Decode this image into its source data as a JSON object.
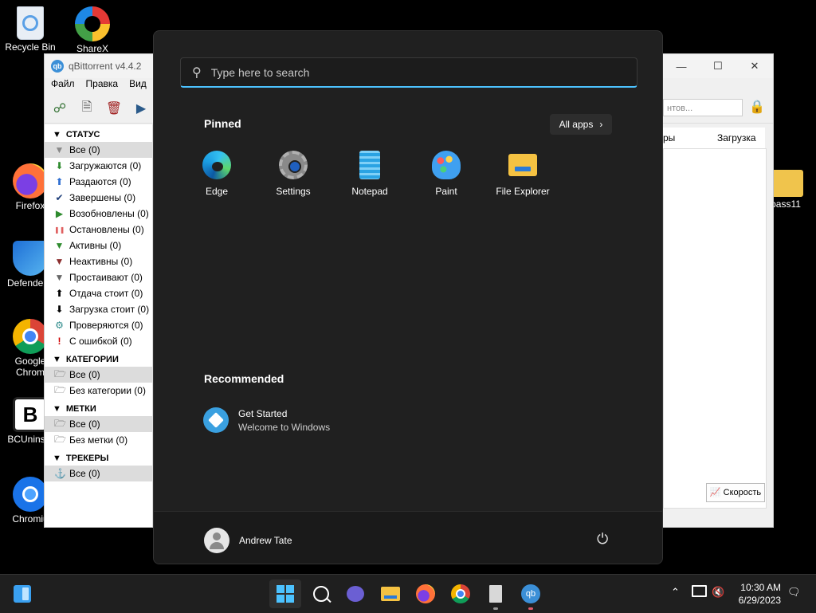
{
  "desktop": {
    "icons": [
      {
        "label": "Recycle Bin",
        "icon": "recycle-bin-icon"
      },
      {
        "label": "ShareX",
        "icon": "sharex-icon"
      },
      {
        "label": "Firefox",
        "icon": "firefox-icon"
      },
      {
        "label": "DefenderC",
        "icon": "defender-icon"
      },
      {
        "label": "Google",
        "label2": "Chrom",
        "icon": "chrome-icon"
      },
      {
        "label": "BCUninsta",
        "icon": "bcuninstaller-icon"
      },
      {
        "label": "Chromiu",
        "icon": "chromium-icon"
      },
      {
        "label": "pass11",
        "icon": "folder-icon"
      }
    ]
  },
  "qbittorrent": {
    "title": "qBittorrent v4.4.2",
    "menu": [
      "Файл",
      "Правка",
      "Вид"
    ],
    "search_placeholder": "нтов...",
    "columns": [
      "ры",
      "Загрузка"
    ],
    "speed_button": "Скорость",
    "sections": {
      "status": {
        "title": "СТАТУС",
        "items": [
          {
            "label": "Все (0)",
            "icon": "filter-icon",
            "color": "#888888"
          },
          {
            "label": "Загружаются (0)",
            "icon": "arrow-down-icon",
            "color": "#2e8b2e"
          },
          {
            "label": "Раздаются (0)",
            "icon": "arrow-up-icon",
            "color": "#2f6fd1"
          },
          {
            "label": "Завершены (0)",
            "icon": "check-icon",
            "color": "#1f3f7a"
          },
          {
            "label": "Возобновлены (0)",
            "icon": "play-icon",
            "color": "#2e8b2e"
          },
          {
            "label": "Остановлены (0)",
            "icon": "pause-icon",
            "color": "#e06060"
          },
          {
            "label": "Активны (0)",
            "icon": "filter-icon",
            "color": "#2e8b2e"
          },
          {
            "label": "Неактивны (0)",
            "icon": "filter-icon",
            "color": "#8b2e2e"
          },
          {
            "label": "Простаивают (0)",
            "icon": "filter-icon",
            "color": "#666666"
          },
          {
            "label": "Отдача стоит (0)",
            "icon": "arrow-up-icon",
            "color": "#000000"
          },
          {
            "label": "Загрузка стоит (0)",
            "icon": "arrow-down-icon",
            "color": "#000000"
          },
          {
            "label": "Проверяются (0)",
            "icon": "gear-icon",
            "color": "#2e8b8b"
          },
          {
            "label": "С ошибкой (0)",
            "icon": "error-icon",
            "color": "#d00000"
          }
        ]
      },
      "categories": {
        "title": "КАТЕГОРИИ",
        "items": [
          {
            "label": "Все (0)",
            "icon": "folder-open-icon"
          },
          {
            "label": "Без категории (0)",
            "icon": "folder-open-icon"
          }
        ]
      },
      "tags": {
        "title": "МЕТКИ",
        "items": [
          {
            "label": "Все (0)",
            "icon": "folder-open-icon"
          },
          {
            "label": "Без метки (0)",
            "icon": "folder-open-icon"
          }
        ]
      },
      "trackers": {
        "title": "ТРЕКЕРЫ",
        "items": [
          {
            "label": "Все (0)",
            "icon": "tracker-icon"
          }
        ]
      }
    }
  },
  "start_menu": {
    "search_placeholder": "Type here to search",
    "pinned_title": "Pinned",
    "all_apps": "All apps",
    "pinned": [
      {
        "label": "Edge",
        "icon": "edge-icon"
      },
      {
        "label": "Settings",
        "icon": "settings-icon"
      },
      {
        "label": "Notepad",
        "icon": "notepad-icon"
      },
      {
        "label": "Paint",
        "icon": "paint-icon"
      },
      {
        "label": "File Explorer",
        "icon": "file-explorer-icon"
      }
    ],
    "recommended_title": "Recommended",
    "recommended": [
      {
        "title": "Get Started",
        "subtitle": "Welcome to Windows",
        "icon": "get-started-icon"
      }
    ],
    "user": "Andrew Tate"
  },
  "taskbar": {
    "time": "10:30 AM",
    "date": "6/29/2023",
    "apps": [
      "widgets-icon",
      "start-icon",
      "search-icon",
      "teams-icon",
      "file-explorer-icon",
      "firefox-icon",
      "chrome-icon",
      "document-icon",
      "qbittorrent-icon"
    ]
  }
}
